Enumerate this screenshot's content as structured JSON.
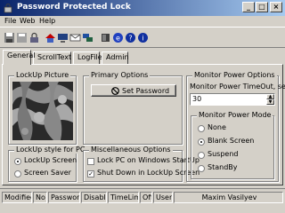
{
  "window": {
    "title": "Password Protected Lock"
  },
  "menu": {
    "file": "File",
    "web": "Web",
    "help": "Help"
  },
  "tabs": [
    "General",
    "ScrollText",
    "LogFile",
    "Admin"
  ],
  "lockup_picture": {
    "title": "LockUp Picture"
  },
  "primary_options": {
    "title": "Primary Options",
    "set_password": "Set Password"
  },
  "lockup_style": {
    "title": "LockUp style for PC",
    "options": [
      "LockUp Screen",
      "Screen Saver"
    ],
    "selected": "LockUp Screen"
  },
  "misc_options": {
    "title": "Miscellaneous Options",
    "lock_startup": "Lock PC on Windows StartUp",
    "shutdown_lockup": "Shut Down in LockUp Screen"
  },
  "monitor": {
    "title": "Monitor Power Options",
    "timeout_label": "Monitor Power TimeOut, secs:",
    "timeout_value": "30",
    "mode_title": "Monitor Power Mode",
    "modes": [
      "None",
      "Blank Screen",
      "Suspend",
      "StandBy"
    ],
    "selected_mode": "Blank Screen"
  },
  "status": {
    "modified_label": "Modified:",
    "modified_value": "No",
    "password_label": "Password:",
    "password_value": "Disable",
    "timelimit_label": "TimeLimit:",
    "timelimit_value": "Off",
    "user_label": "User:",
    "user_value": "Maxim Vasilyev"
  }
}
